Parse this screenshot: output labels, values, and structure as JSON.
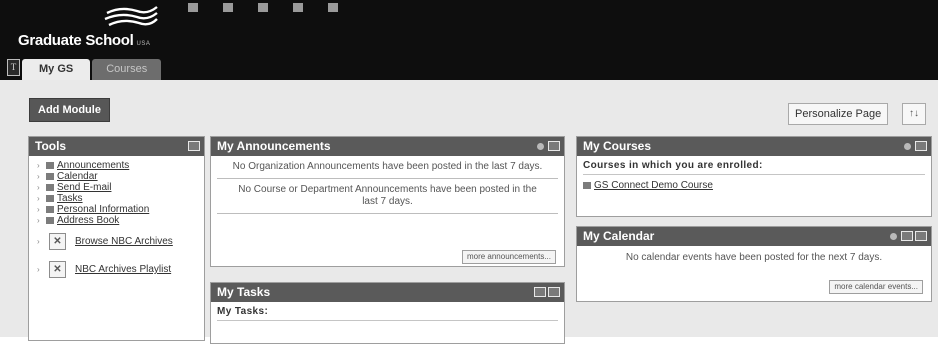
{
  "header": {
    "logo": {
      "name": "Graduate School",
      "suffix": "USA"
    },
    "top_nav": [
      {
        "icon": "users-icon",
        "label": ""
      },
      {
        "icon": "grid-icon",
        "label": ""
      },
      {
        "icon": "bars-icon",
        "label": ""
      },
      {
        "icon": "book-icon",
        "label": ""
      },
      {
        "icon": "speaker-icon",
        "label": ""
      }
    ],
    "tabs": [
      {
        "label": "My GS",
        "active": true
      },
      {
        "label": "Courses",
        "active": false
      }
    ]
  },
  "toolbar": {
    "add_module": "Add Module",
    "personalize": "Personalize Page",
    "reorder_icon": "↑↓"
  },
  "tools": {
    "title": "Tools",
    "items": [
      {
        "label": "Announcements",
        "icon": "megaphone-icon"
      },
      {
        "label": "Calendar",
        "icon": "calendar-icon"
      },
      {
        "label": "Send E-mail",
        "icon": "envelope-icon"
      },
      {
        "label": "Tasks",
        "icon": "tasks-icon"
      },
      {
        "label": "Personal Information",
        "icon": "user-info-icon"
      },
      {
        "label": "Address Book",
        "icon": "address-book-icon"
      }
    ],
    "big_items": [
      {
        "label": "Browse NBC Archives",
        "icon": "broken-image-icon"
      },
      {
        "label": "NBC Archives Playlist",
        "icon": "broken-image-icon"
      }
    ]
  },
  "announcements": {
    "title": "My Announcements",
    "org_text": "No Organization Announcements have been posted in the last 7 days.",
    "course_text": "No Course or Department Announcements have been posted in the last 7 days.",
    "more": "more announcements..."
  },
  "tasks": {
    "title": "My Tasks",
    "subhead": "My Tasks:"
  },
  "courses": {
    "title": "My Courses",
    "subhead": "Courses in which you are enrolled:",
    "items": [
      {
        "label": "GS Connect Demo Course",
        "icon": "course-icon"
      }
    ]
  },
  "calendar": {
    "title": "My Calendar",
    "text": "No calendar events have been posted for the next 7 days.",
    "more": "more calendar events..."
  },
  "colors": {
    "header_bg": "#0e0e0e",
    "module_head": "#5a5a5a",
    "content_bg": "#e9e9e9"
  }
}
